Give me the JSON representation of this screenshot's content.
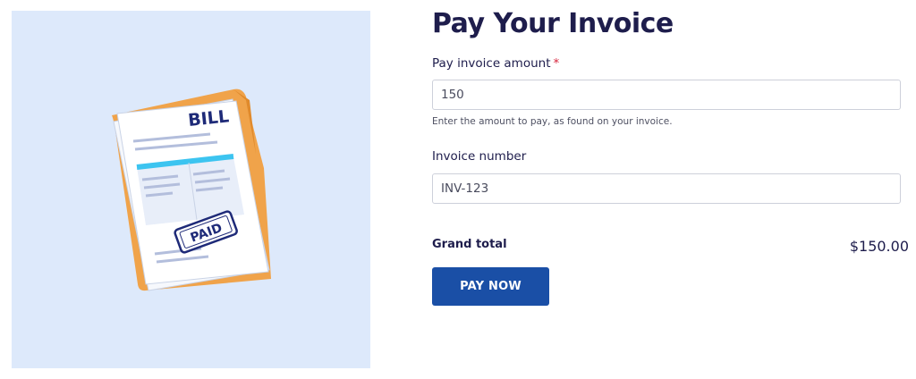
{
  "page": {
    "title": "Pay Your Invoice"
  },
  "illustration": {
    "bill_text": "BILL",
    "stamp_text": "PAID",
    "colors": {
      "panel": "#dde9fb",
      "folder": "#f0a34a",
      "paper": "#ffffff",
      "accent": "#3cc4f0",
      "ink": "#1e2a78"
    }
  },
  "form": {
    "amount": {
      "label": "Pay invoice amount",
      "required_marker": "*",
      "value": "150",
      "helper": "Enter the amount to pay, as found on your invoice."
    },
    "invoice_number": {
      "label": "Invoice number",
      "value": "INV-123"
    },
    "grand_total": {
      "label": "Grand total",
      "value": "$150.00"
    },
    "pay_button": {
      "label": "PAY NOW"
    }
  }
}
